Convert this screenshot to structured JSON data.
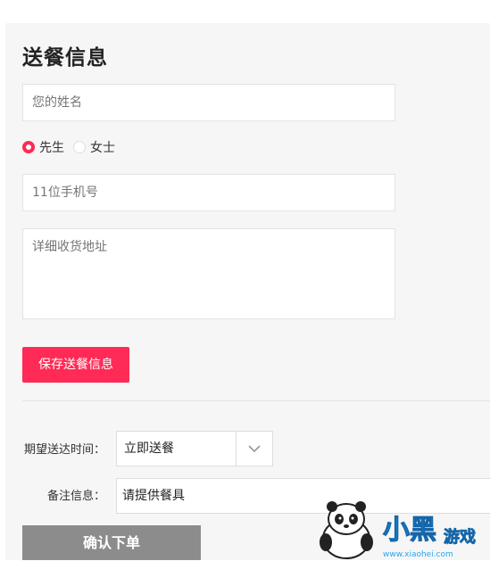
{
  "title": "送餐信息",
  "fields": {
    "name_placeholder": "您的姓名",
    "phone_placeholder": "11位手机号",
    "address_placeholder": "详细收货地址"
  },
  "gender": {
    "options": [
      {
        "label": "先生",
        "selected": true
      },
      {
        "label": "女士",
        "selected": false
      }
    ]
  },
  "save_button": "保存送餐信息",
  "delivery_time": {
    "label": "期望送达时间：",
    "value": "立即送餐"
  },
  "note": {
    "label": "备注信息：",
    "value": "请提供餐具"
  },
  "confirm_button": "确认下单",
  "watermark": {
    "brand": "小黑游戏",
    "url": "www.xiaohei.com"
  },
  "colors": {
    "accent": "#ff2a55",
    "confirm_bg": "#8c8c8c",
    "panel_bg": "#f6f6f6"
  }
}
